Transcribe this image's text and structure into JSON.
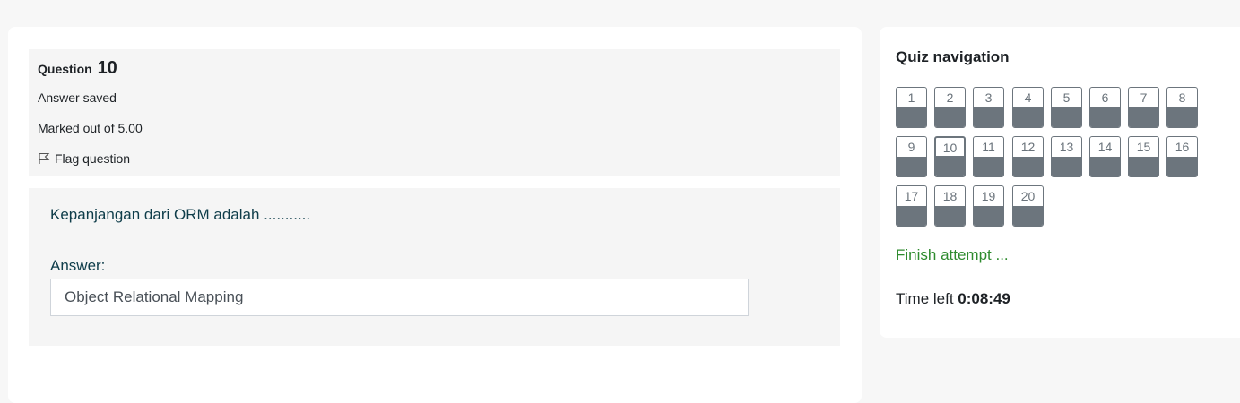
{
  "question": {
    "label": "Question",
    "number": "10",
    "state": "Answer saved",
    "grade": "Marked out of 5.00",
    "flag_label": "Flag question",
    "text": "Kepanjangan dari ORM adalah ...........",
    "answer_label": "Answer:",
    "answer_value": "Object Relational Mapping"
  },
  "nav": {
    "title": "Quiz navigation",
    "current": 10,
    "items": [
      {
        "label": "1",
        "answered": 1
      },
      {
        "label": "2",
        "answered": 1
      },
      {
        "label": "3",
        "answered": 1
      },
      {
        "label": "4",
        "answered": 1
      },
      {
        "label": "5",
        "answered": 1
      },
      {
        "label": "6",
        "answered": 1
      },
      {
        "label": "7",
        "answered": 1
      },
      {
        "label": "8",
        "answered": 1
      },
      {
        "label": "9",
        "answered": 1
      },
      {
        "label": "10",
        "answered": 1
      },
      {
        "label": "11",
        "answered": 1
      },
      {
        "label": "12",
        "answered": 1
      },
      {
        "label": "13",
        "answered": 1
      },
      {
        "label": "14",
        "answered": 1
      },
      {
        "label": "15",
        "answered": 1
      },
      {
        "label": "16",
        "answered": 1
      },
      {
        "label": "17",
        "answered": 1
      },
      {
        "label": "18",
        "answered": 1
      },
      {
        "label": "19",
        "answered": 1
      },
      {
        "label": "20",
        "answered": 1
      }
    ],
    "finish_label": "Finish attempt ...",
    "time_label": "Time left",
    "time_value": "0:08:49"
  },
  "icons": {
    "flag": "flag-icon"
  },
  "colors": {
    "finish_link": "#2e8b2e",
    "answered_fill": "#6c757d",
    "question_text": "#0f3d4a"
  }
}
